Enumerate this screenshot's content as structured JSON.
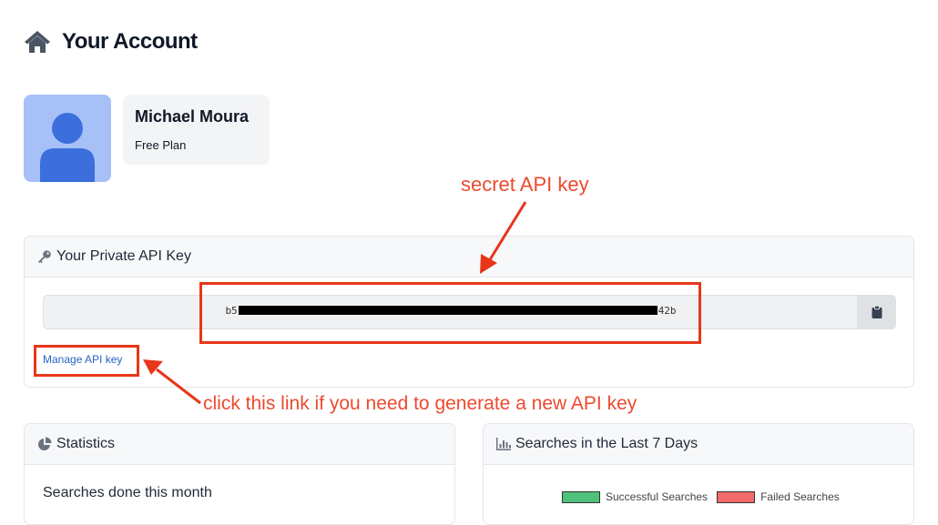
{
  "header": {
    "title": "Your Account",
    "icon": "home-icon"
  },
  "profile": {
    "name": "Michael Moura",
    "plan": "Free Plan",
    "avatar_icon": "user-icon"
  },
  "api_key_card": {
    "title": "Your Private API Key",
    "title_icon": "key-icon",
    "key_prefix": "b5",
    "key_suffix": "42b",
    "copy_icon": "clipboard-icon",
    "manage_link": "Manage API key"
  },
  "statistics_card": {
    "title": "Statistics",
    "title_icon": "pie-chart-icon",
    "subtitle": "Searches done this month"
  },
  "searches_card": {
    "title": "Searches in the Last 7 Days",
    "title_icon": "bar-chart-icon",
    "legend": [
      {
        "label": "Successful Searches",
        "color": "#4ec27a"
      },
      {
        "label": "Failed Searches",
        "color": "#f26a6a"
      }
    ]
  },
  "annotations": {
    "secret_label": "secret API key",
    "link_label": "click this link if you need to generate a new API key",
    "color": "#ec4a2f"
  }
}
